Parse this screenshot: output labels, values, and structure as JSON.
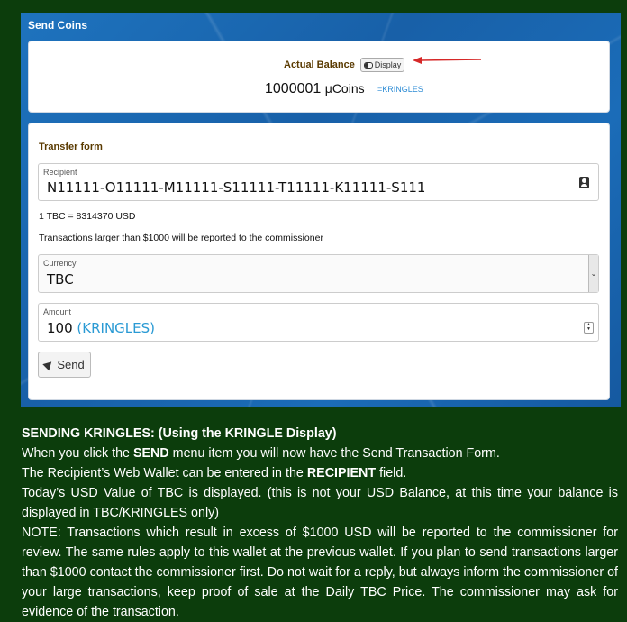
{
  "panel": {
    "title": "Send Coins"
  },
  "balance": {
    "label": "Actual Balance",
    "display_button": "Display",
    "amount": "1000001",
    "unit": "μCoins",
    "kringles_tag": "=KRINGLES"
  },
  "form": {
    "title": "Transfer form",
    "recipient_label": "Recipient",
    "recipient_value": "N11111-O11111-M11111-S11111-T11111-K11111-S111",
    "rate_text": "1 TBC = 8314370 USD",
    "notice_text": "Transactions larger than $1000 will be reported to the commissioner",
    "currency_label": "Currency",
    "currency_value": "TBC",
    "amount_label": "Amount",
    "amount_value": "100",
    "amount_unit": "(KRINGLES)",
    "send_label": "Send"
  },
  "article": {
    "heading": "SENDING KRINGLES: (Using the KRINGLE Display)",
    "p1_a": "When you click the ",
    "p1_b": "SEND",
    "p1_c": " menu item you will now have the Send Transaction Form.",
    "p2_a": "The Recipient’s Web Wallet can be entered in the ",
    "p2_b": "RECIPIENT",
    "p2_c": " field.",
    "p3": "Today’s USD Value of TBC is displayed. (this is not your USD Balance, at this time your balance is displayed in TBC/KRINGLES only)",
    "p4": "NOTE: Transactions which result in excess of $1000 USD will be reported to the commissioner for review.  The same rules apply to this wallet at the previous wallet.  If you plan to send transactions larger than $1000 contact the commissioner first.  Do not wait for a reply, but always inform the commissioner of your large transactions, keep proof of sale at the Daily TBC Price.  The commissioner may ask for evidence of the transaction."
  },
  "colors": {
    "background": "#0c3d0c",
    "panel": "#1e73be",
    "accent": "#2a8ad4",
    "arrow": "#d62828"
  }
}
